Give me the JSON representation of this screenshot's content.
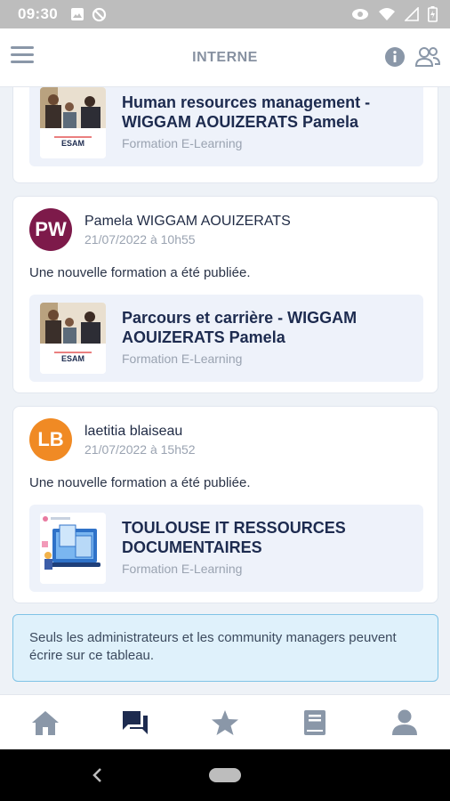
{
  "status_bar": {
    "time": "09:30",
    "icons": [
      "image-icon",
      "data-saver-icon",
      "eye-icon",
      "wifi-icon",
      "signal-icon",
      "battery-icon"
    ]
  },
  "header": {
    "title": "INTERNE",
    "icons": [
      "menu-icon",
      "info-icon",
      "members-icon"
    ]
  },
  "posts": [
    {
      "attachment": {
        "title": "Human resources management - WIGGAM AOUIZERATS Pamela",
        "subtitle": "Formation E-Learning",
        "thumb_caption": "ESAM"
      }
    },
    {
      "author": "Pamela WIGGAM AOUIZERATS",
      "initials": "PW",
      "avatar_color": "#7d1a4a",
      "date": "21/07/2022 à 10h55",
      "text": "Une nouvelle formation a été publiée.",
      "attachment": {
        "title": "Parcours et carrière - WIGGAM AOUIZERATS Pamela",
        "subtitle": "Formation E-Learning",
        "thumb_caption": "ESAM"
      }
    },
    {
      "author": "laetitia blaiseau",
      "initials": "LB",
      "avatar_color": "#f08a24",
      "date": "21/07/2022 à 15h52",
      "text": "Une nouvelle formation a été publiée.",
      "attachment": {
        "title": "TOULOUSE IT RESSOURCES DOCUMENTAIRES",
        "subtitle": "Formation E-Learning"
      }
    }
  ],
  "notice": "Seuls les administrateurs et les community managers peuvent écrire sur ce tableau.",
  "bottom_nav": {
    "items": [
      "home-icon",
      "chat-icon",
      "star-icon",
      "book-icon",
      "profile-icon"
    ],
    "active": "chat-icon",
    "active_color": "#1d2b4f",
    "inactive_color": "#8a97a8"
  }
}
